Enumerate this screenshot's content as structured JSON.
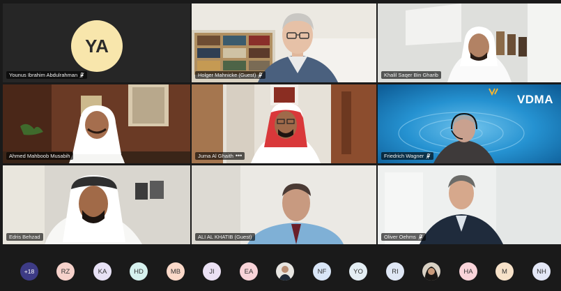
{
  "tiles": [
    {
      "name": "Younus Ibrahim Abdulrahman",
      "initials": "YA",
      "mic": "muted"
    },
    {
      "name": "Holger Mahnicke (Guest)",
      "mic": "muted"
    },
    {
      "name": "Khalil Saqer Bin Gharib",
      "mic": "none"
    },
    {
      "name": "Ahmed Mahboob Musabih",
      "mic": "none"
    },
    {
      "name": "Juma Al Ghaith",
      "mic": "menu",
      "menu": "•••"
    },
    {
      "name": "Friedrich Wagner",
      "mic": "muted",
      "logo": "VDMA"
    },
    {
      "name": "Edris Behzad",
      "mic": "none"
    },
    {
      "name": "ALI AL KHATIB (Guest)",
      "mic": "none"
    },
    {
      "name": "Oliver Oehms",
      "mic": "muted"
    }
  ],
  "participants_strip": {
    "more_count": "+18",
    "chips": [
      "RZ",
      "KA",
      "HD",
      "MB",
      "JI",
      "EA",
      "",
      "NF",
      "YO",
      "RI",
      "",
      "HA",
      "M",
      "NH"
    ],
    "chip_colors": [
      "#f6d2cb",
      "#e7e1f5",
      "#d6f1ee",
      "#fbd9c9",
      "#ebe1f4",
      "#f8d3d8",
      "#ffffff",
      "#d9e6f7",
      "#e4eef4",
      "#dfe7f5",
      "#ffffff",
      "#fad4da",
      "#f7e2c9",
      "#e3e7f6"
    ]
  },
  "colors": {
    "accent_more": "#3d3b85",
    "avatar_bg": "#f8e6ac",
    "background": "#1a1a1a"
  }
}
